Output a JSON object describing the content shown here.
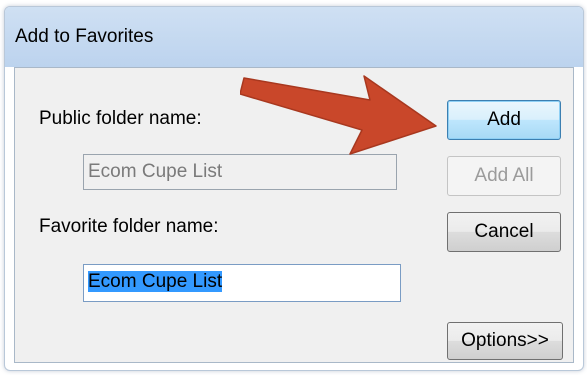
{
  "window": {
    "title": "Add to Favorites"
  },
  "form": {
    "public_folder_label": "Public folder name:",
    "public_folder_value": "Ecom Cupe List",
    "favorite_folder_label": "Favorite folder name:",
    "favorite_folder_value": "Ecom Cupe List"
  },
  "buttons": {
    "add": "Add",
    "add_all": "Add All",
    "cancel": "Cancel",
    "options": "Options>>"
  },
  "annotation": {
    "arrow_color": "#c9472a",
    "arrow_icon": "arrow-right-icon"
  }
}
